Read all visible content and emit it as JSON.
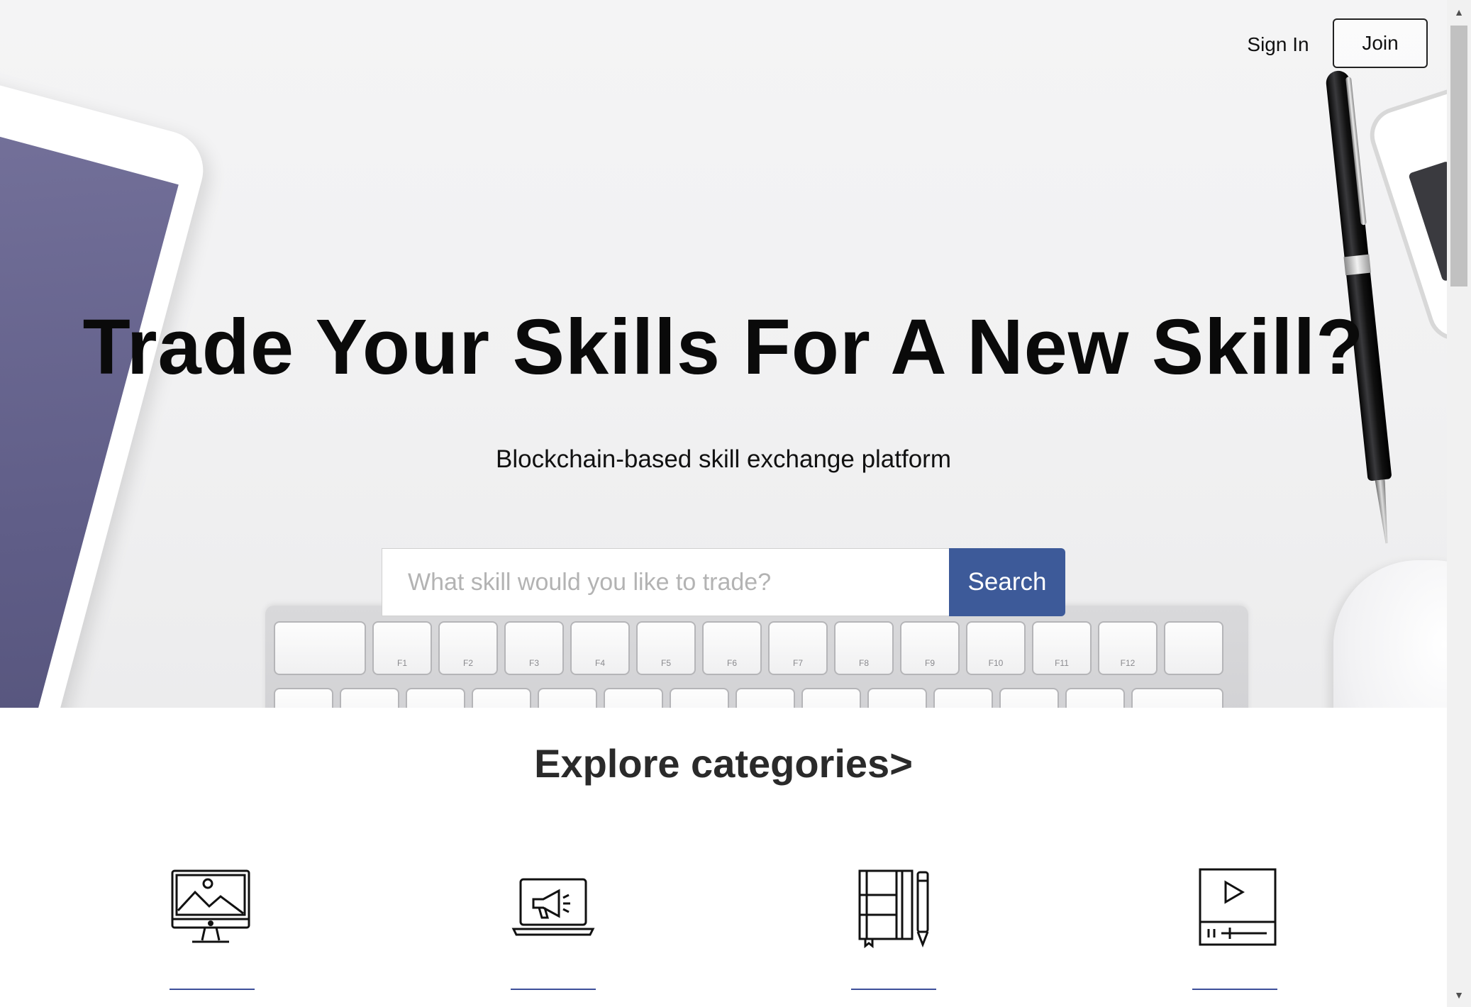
{
  "header": {
    "signin_label": "Sign In",
    "join_label": "Join"
  },
  "hero": {
    "title": "Trade Your Skills For A New Skill?",
    "subtitle": "Blockchain-based skill exchange platform",
    "search": {
      "placeholder": "What skill would you like to trade?",
      "value": "",
      "button_label": "Search"
    },
    "keyboard_keys": [
      "",
      "F1",
      "F2",
      "F3",
      "F4",
      "F5",
      "F6",
      "F7",
      "F8",
      "F9",
      "F10",
      "F11",
      "F12",
      ""
    ]
  },
  "categories": {
    "title": "Explore categories>",
    "items": [
      {
        "icon": "monitor-image-icon"
      },
      {
        "icon": "laptop-megaphone-icon"
      },
      {
        "icon": "notebook-pencil-icon"
      },
      {
        "icon": "video-player-icon"
      }
    ]
  },
  "colors": {
    "accent": "#3d5a99",
    "text": "#111111",
    "link_underline": "#3d4f9a"
  }
}
